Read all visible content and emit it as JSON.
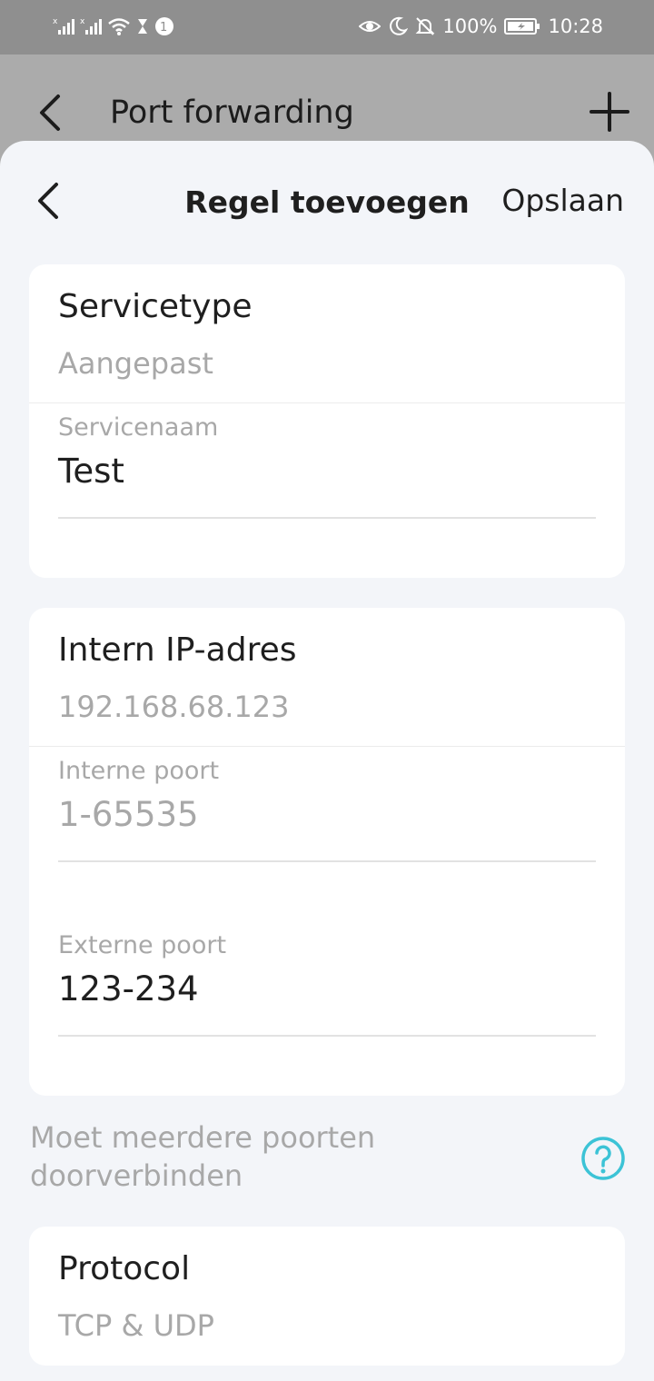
{
  "status_bar": {
    "battery": "100%",
    "time": "10:28",
    "icons": [
      "signal-icon",
      "signal-icon",
      "wifi-icon",
      "hourglass-icon",
      "notification-badge-icon",
      "eye-icon",
      "moon-icon",
      "bell-off-icon",
      "battery-icon"
    ]
  },
  "background_page": {
    "title": "Port forwarding",
    "back_icon": "chevron-left-icon",
    "add_icon": "plus-icon"
  },
  "header": {
    "title": "Regel toevoegen",
    "save_label": "Opslaan",
    "back_icon": "chevron-left-icon"
  },
  "service": {
    "type_label": "Servicetype",
    "type_value": "Aangepast",
    "name_label": "Servicenaam",
    "name_value": "Test"
  },
  "network": {
    "ip_label": "Intern IP-adres",
    "ip_value": "192.168.68.123",
    "internal_port_label": "Interne poort",
    "internal_port_placeholder": "1-65535",
    "external_port_label": "Externe poort",
    "external_port_value": "123-234"
  },
  "multi_port": {
    "label": "Moet meerdere poorten doorverbinden",
    "help_icon": "help-circle-icon",
    "accent": "#3cc3d6"
  },
  "protocol": {
    "label": "Protocol",
    "value": "TCP & UDP"
  }
}
